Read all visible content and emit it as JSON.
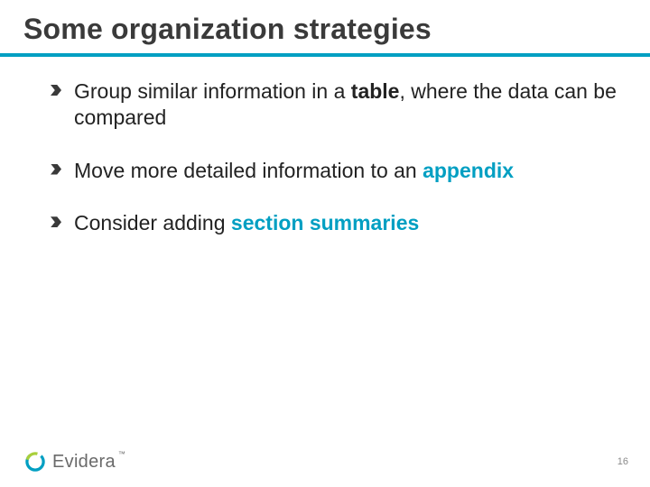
{
  "title": "Some organization strategies",
  "bullets": [
    {
      "segments": [
        {
          "text": "Group similar information in a ",
          "style": "plain"
        },
        {
          "text": "table",
          "style": "bold"
        },
        {
          "text": ", where the data can be compared",
          "style": "plain"
        }
      ]
    },
    {
      "segments": [
        {
          "text": "Move more detailed information to an ",
          "style": "plain"
        },
        {
          "text": "appendix",
          "style": "teal-bold"
        }
      ]
    },
    {
      "segments": [
        {
          "text": "Consider adding ",
          "style": "plain"
        },
        {
          "text": "section summaries",
          "style": "teal-bold"
        }
      ]
    }
  ],
  "logo_text": "Evidera",
  "page_number": "16",
  "colors": {
    "accent": "#009fc2",
    "body": "#3a3a3a"
  }
}
